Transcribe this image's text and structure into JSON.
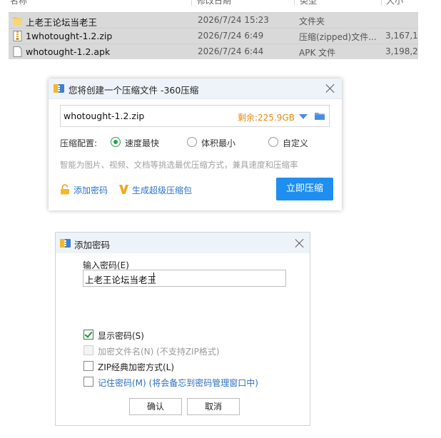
{
  "explorer": {
    "headers": [
      "名称",
      "修改日期",
      "类型",
      "大小"
    ],
    "files": [
      {
        "name": "上老王论坛当老王",
        "date": "2026/7/24 15:23",
        "type": "文件夹",
        "size": "",
        "icon": "folder-icon"
      },
      {
        "name": "1whotought-1.2.zip",
        "date": "2026/7/24 6:49",
        "type": "压缩(zipped)文件...",
        "size": "3,167,1",
        "icon": "zip-file-icon"
      },
      {
        "name": "whotought-1.2.apk",
        "date": "2026/7/24 6:44",
        "type": "APK 文件",
        "size": "3,198,2",
        "icon": "file-icon"
      }
    ]
  },
  "compress_dialog": {
    "title": "您将创建一个压缩文件 -360压缩",
    "file_name": "whotought-1.2.zip",
    "free_space": "剩余:225.9GB",
    "config_label": "压缩配置:",
    "options": [
      {
        "label": "速度最快",
        "selected": true
      },
      {
        "label": "体积最小",
        "selected": false
      },
      {
        "label": "自定义",
        "selected": false
      }
    ],
    "hint": "智能为图片、视频、文档等挑选最优压缩方式，兼具速度和压缩率",
    "add_password": "添加密码",
    "super_compress": "生成超级压缩包",
    "compress_button": "立即压缩",
    "accent_color": "#1e8ff0"
  },
  "password_dialog": {
    "title": "添加密码",
    "input_label": "输入密码(E)",
    "password_value": "上老王论坛当老王",
    "checkboxes": [
      {
        "label": "显示密码(S)",
        "checked": true,
        "disabled": false
      },
      {
        "label": "加密文件名(N) (不支持ZIP格式)",
        "checked": false,
        "disabled": true
      },
      {
        "label": "ZIP经典加密方式(L)",
        "checked": false,
        "disabled": false
      },
      {
        "label": "记住密码(M) (将会备忘到密码管理窗口中)",
        "checked": false,
        "disabled": false
      }
    ],
    "ok_button": "确认",
    "cancel_button": "取消"
  }
}
